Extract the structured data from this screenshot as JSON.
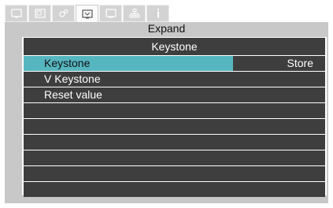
{
  "tabs": [
    {
      "icon": "picture-icon",
      "active": false
    },
    {
      "icon": "display-icon",
      "active": false
    },
    {
      "icon": "settings-icon",
      "active": false
    },
    {
      "icon": "expand-icon",
      "active": true
    },
    {
      "icon": "screen-icon",
      "active": false
    },
    {
      "icon": "network-icon",
      "active": false
    },
    {
      "icon": "info-icon",
      "active": false
    }
  ],
  "panel": {
    "title": "Expand"
  },
  "submenu": {
    "title": "Keystone",
    "rows": [
      {
        "label": "Keystone",
        "value": "Store",
        "selected": true
      },
      {
        "label": "V Keystone",
        "value": ""
      },
      {
        "label": "Reset value",
        "value": ""
      },
      {
        "label": "",
        "value": ""
      },
      {
        "label": "",
        "value": ""
      },
      {
        "label": "",
        "value": ""
      },
      {
        "label": "",
        "value": ""
      },
      {
        "label": "",
        "value": ""
      },
      {
        "label": "",
        "value": ""
      }
    ]
  },
  "colors": {
    "highlight": "#56b6c0",
    "menu_row": "#3e3e3e",
    "panel": "#c8c8c8",
    "tab": "#d3d3d3"
  }
}
